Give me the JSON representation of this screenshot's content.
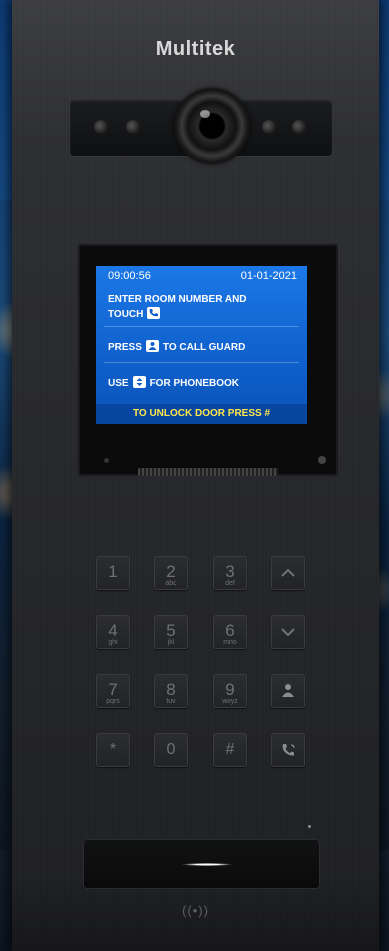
{
  "brand": "Multitek",
  "screen": {
    "time": "09:00:56",
    "date": "01-01-2021",
    "line1_a": "ENTER ROOM NUMBER AND",
    "line1_b": "TOUCH",
    "line2_a": "PRESS",
    "line2_b": "TO CALL GUARD",
    "line3_a": "USE",
    "line3_b": "FOR PHONEBOOK",
    "footer": "TO UNLOCK  DOOR PRESS #"
  },
  "keypad": [
    {
      "digit": "1",
      "letters": ""
    },
    {
      "digit": "2",
      "letters": "abc"
    },
    {
      "digit": "3",
      "letters": "def"
    },
    {
      "symbol": "up-arrow"
    },
    {
      "digit": "4",
      "letters": "ghi"
    },
    {
      "digit": "5",
      "letters": "jkl"
    },
    {
      "digit": "6",
      "letters": "mno"
    },
    {
      "symbol": "down-arrow"
    },
    {
      "digit": "7",
      "letters": "pqrs"
    },
    {
      "digit": "8",
      "letters": "tuv"
    },
    {
      "digit": "9",
      "letters": "wxyz"
    },
    {
      "symbol": "guard"
    },
    {
      "digit": "*",
      "letters": ""
    },
    {
      "digit": "0",
      "letters": ""
    },
    {
      "digit": "#",
      "letters": ""
    },
    {
      "symbol": "call"
    }
  ],
  "nfc_label": "((•))",
  "colors": {
    "screen_blue": "#1b78e6",
    "footer_text": "#ffe84a",
    "panel": "#2d2e31"
  }
}
